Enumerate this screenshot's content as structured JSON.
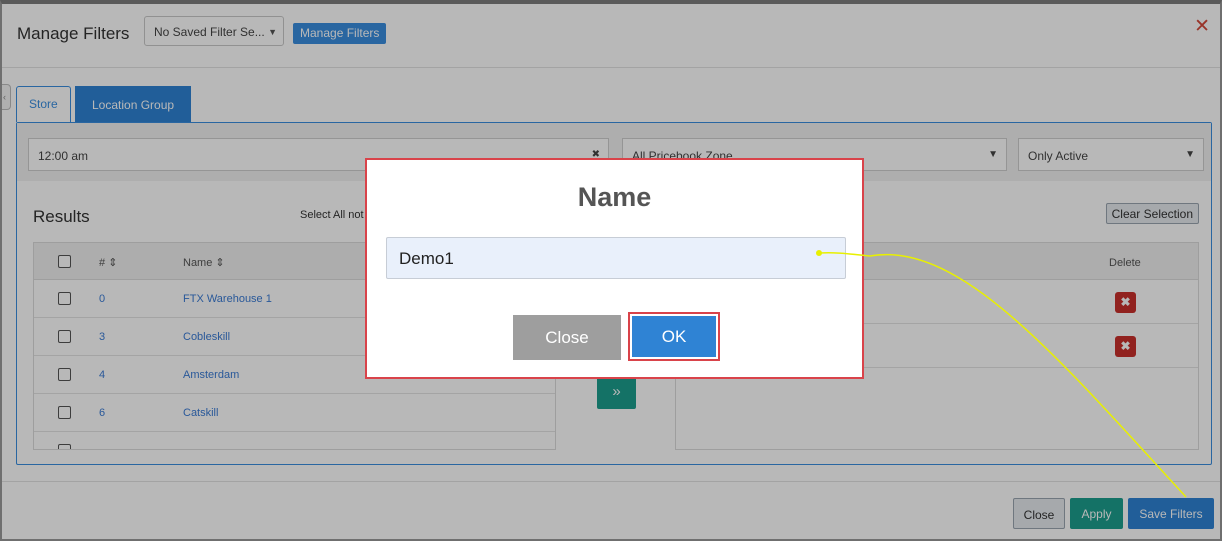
{
  "header": {
    "title": "Manage Filters",
    "saved_filter": "No Saved Filter Se...",
    "manage_button": "Manage Filters",
    "close_icon": "close-x-icon"
  },
  "tabs": [
    {
      "label": "Store",
      "active": true
    },
    {
      "label": "Location Group",
      "active": false
    }
  ],
  "filters": {
    "time": "12:00 am",
    "pricebook_zone": "All Pricebook Zone",
    "status": "Only Active"
  },
  "results": {
    "title": "Results",
    "select_all": "Select All not",
    "clear_selection": "Clear Selection",
    "columns": {
      "num": "#",
      "name": "Name"
    },
    "rows": [
      {
        "num": "0",
        "name": "FTX Warehouse 1"
      },
      {
        "num": "3",
        "name": "Cobleskill"
      },
      {
        "num": "4",
        "name": "Amsterdam"
      },
      {
        "num": "6",
        "name": "Catskill"
      }
    ]
  },
  "selected": {
    "delete_header": "Delete",
    "move_glyph": "»",
    "delete_glyph": "✖"
  },
  "footer": {
    "close": "Close",
    "apply": "Apply",
    "save": "Save Filters"
  },
  "modal": {
    "title": "Name",
    "input_value": "Demo1",
    "close": "Close",
    "ok": "OK"
  },
  "colors": {
    "primary": "#2f83d4",
    "teal": "#1c9e8e",
    "danger": "#c9302c",
    "highlight": "#d9434a",
    "annotation": "#e8f000"
  }
}
